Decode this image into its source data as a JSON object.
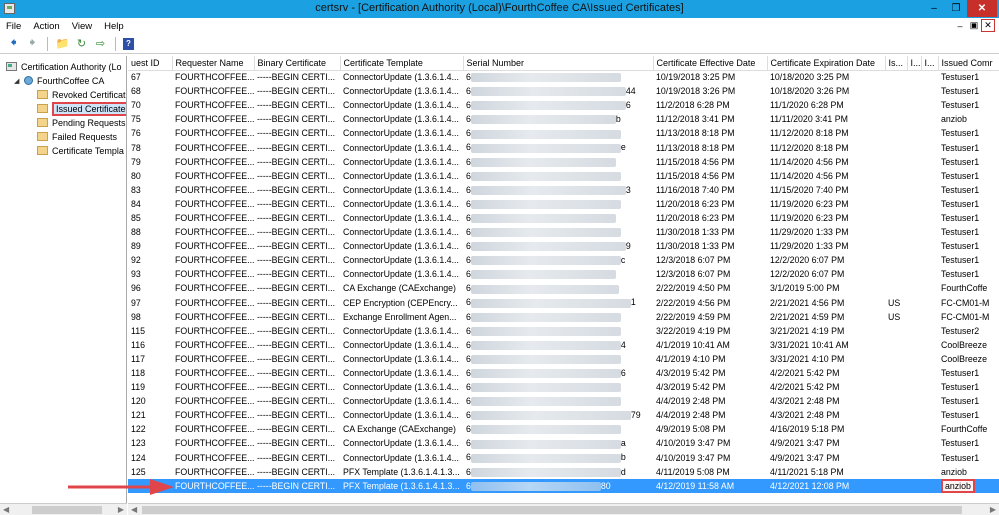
{
  "window": {
    "title": "certsrv - [Certification Authority (Local)\\FourthCoffee CA\\Issued Certificates]",
    "controls": [
      "minimize",
      "restore",
      "close"
    ]
  },
  "menu": {
    "items": [
      "File",
      "Action",
      "View",
      "Help"
    ],
    "mdi_controls": [
      "minimize",
      "restore",
      "close"
    ]
  },
  "toolbar": {
    "buttons": [
      "back-icon",
      "forward-icon",
      "up-folder-icon",
      "refresh-icon",
      "export-icon",
      "help-icon"
    ]
  },
  "tree": {
    "root": "Certification Authority (Local)",
    "ca": "FourthCoffee CA",
    "folders": [
      "Revoked Certificates",
      "Issued Certificates",
      "Pending Requests",
      "Failed Requests",
      "Certificate Templates"
    ],
    "root_shown": "Certification Authority (Lo",
    "folders_shown": [
      "Revoked Certificat",
      "Issued Certificates",
      "Pending Requests",
      "Failed Requests",
      "Certificate Templa"
    ],
    "selected": "Issued Certificates"
  },
  "grid": {
    "columns": [
      "Request ID",
      "Requester Name",
      "Binary Certificate",
      "Certificate Template",
      "Serial Number",
      "Certificate Effective Date",
      "Certificate Expiration Date",
      "Is...",
      "I...",
      "I...",
      "Issued Comm"
    ],
    "columns_shown": [
      "uest ID",
      "Requester Name",
      "Binary Certificate",
      "Certificate Template",
      "Serial Number",
      "Certificate Effective Date",
      "Certificate Expiration Date",
      "Is...",
      "I...",
      "I...",
      "Issued Comr"
    ],
    "rows": [
      {
        "id": "67",
        "requester": "FOURTHCOFFEE...",
        "binary": "-----BEGIN CERTI...",
        "template": "ConnectorUpdate (1.3.6.1.4...",
        "serial_tail": "",
        "effective": "10/19/2018 3:25 PM",
        "expiration": "10/18/2020 3:25 PM",
        "c1": "",
        "c2": "",
        "c3": "",
        "issued_cn": "Testuser1"
      },
      {
        "id": "68",
        "requester": "FOURTHCOFFEE...",
        "binary": "-----BEGIN CERTI...",
        "template": "ConnectorUpdate (1.3.6.1.4...",
        "serial_tail": "44",
        "effective": "10/19/2018 3:26 PM",
        "expiration": "10/18/2020 3:26 PM",
        "c1": "",
        "c2": "",
        "c3": "",
        "issued_cn": "Testuser1"
      },
      {
        "id": "70",
        "requester": "FOURTHCOFFEE...",
        "binary": "-----BEGIN CERTI...",
        "template": "ConnectorUpdate (1.3.6.1.4...",
        "serial_tail": "6",
        "effective": "11/2/2018 6:28 PM",
        "expiration": "11/1/2020 6:28 PM",
        "c1": "",
        "c2": "",
        "c3": "",
        "issued_cn": "Testuser1"
      },
      {
        "id": "75",
        "requester": "FOURTHCOFFEE...",
        "binary": "-----BEGIN CERTI...",
        "template": "ConnectorUpdate (1.3.6.1.4...",
        "serial_tail": "b",
        "effective": "11/12/2018 3:41 PM",
        "expiration": "11/11/2020 3:41 PM",
        "c1": "",
        "c2": "",
        "c3": "",
        "issued_cn": "anziob"
      },
      {
        "id": "76",
        "requester": "FOURTHCOFFEE...",
        "binary": "-----BEGIN CERTI...",
        "template": "ConnectorUpdate (1.3.6.1.4...",
        "serial_tail": "",
        "effective": "11/13/2018 8:18 PM",
        "expiration": "11/12/2020 8:18 PM",
        "c1": "",
        "c2": "",
        "c3": "",
        "issued_cn": "Testuser1"
      },
      {
        "id": "78",
        "requester": "FOURTHCOFFEE...",
        "binary": "-----BEGIN CERTI...",
        "template": "ConnectorUpdate (1.3.6.1.4...",
        "serial_tail": "e",
        "effective": "11/13/2018 8:18 PM",
        "expiration": "11/12/2020 8:18 PM",
        "c1": "",
        "c2": "",
        "c3": "",
        "issued_cn": "Testuser1"
      },
      {
        "id": "79",
        "requester": "FOURTHCOFFEE...",
        "binary": "-----BEGIN CERTI...",
        "template": "ConnectorUpdate (1.3.6.1.4...",
        "serial_tail": "",
        "effective": "11/15/2018 4:56 PM",
        "expiration": "11/14/2020 4:56 PM",
        "c1": "",
        "c2": "",
        "c3": "",
        "issued_cn": "Testuser1"
      },
      {
        "id": "80",
        "requester": "FOURTHCOFFEE...",
        "binary": "-----BEGIN CERTI...",
        "template": "ConnectorUpdate (1.3.6.1.4...",
        "serial_tail": "",
        "effective": "11/15/2018 4:56 PM",
        "expiration": "11/14/2020 4:56 PM",
        "c1": "",
        "c2": "",
        "c3": "",
        "issued_cn": "Testuser1"
      },
      {
        "id": "83",
        "requester": "FOURTHCOFFEE...",
        "binary": "-----BEGIN CERTI...",
        "template": "ConnectorUpdate (1.3.6.1.4...",
        "serial_tail": "3",
        "effective": "11/16/2018 7:40 PM",
        "expiration": "11/15/2020 7:40 PM",
        "c1": "",
        "c2": "",
        "c3": "",
        "issued_cn": "Testuser1"
      },
      {
        "id": "84",
        "requester": "FOURTHCOFFEE...",
        "binary": "-----BEGIN CERTI...",
        "template": "ConnectorUpdate (1.3.6.1.4...",
        "serial_tail": "",
        "effective": "11/20/2018 6:23 PM",
        "expiration": "11/19/2020 6:23 PM",
        "c1": "",
        "c2": "",
        "c3": "",
        "issued_cn": "Testuser1"
      },
      {
        "id": "85",
        "requester": "FOURTHCOFFEE...",
        "binary": "-----BEGIN CERTI...",
        "template": "ConnectorUpdate (1.3.6.1.4...",
        "serial_tail": "",
        "effective": "11/20/2018 6:23 PM",
        "expiration": "11/19/2020 6:23 PM",
        "c1": "",
        "c2": "",
        "c3": "",
        "issued_cn": "Testuser1"
      },
      {
        "id": "88",
        "requester": "FOURTHCOFFEE...",
        "binary": "-----BEGIN CERTI...",
        "template": "ConnectorUpdate (1.3.6.1.4...",
        "serial_tail": "",
        "effective": "11/30/2018 1:33 PM",
        "expiration": "11/29/2020 1:33 PM",
        "c1": "",
        "c2": "",
        "c3": "",
        "issued_cn": "Testuser1"
      },
      {
        "id": "89",
        "requester": "FOURTHCOFFEE...",
        "binary": "-----BEGIN CERTI...",
        "template": "ConnectorUpdate (1.3.6.1.4...",
        "serial_tail": "9",
        "effective": "11/30/2018 1:33 PM",
        "expiration": "11/29/2020 1:33 PM",
        "c1": "",
        "c2": "",
        "c3": "",
        "issued_cn": "Testuser1"
      },
      {
        "id": "92",
        "requester": "FOURTHCOFFEE...",
        "binary": "-----BEGIN CERTI...",
        "template": "ConnectorUpdate (1.3.6.1.4...",
        "serial_tail": "c",
        "effective": "12/3/2018 6:07 PM",
        "expiration": "12/2/2020 6:07 PM",
        "c1": "",
        "c2": "",
        "c3": "",
        "issued_cn": "Testuser1"
      },
      {
        "id": "93",
        "requester": "FOURTHCOFFEE...",
        "binary": "-----BEGIN CERTI...",
        "template": "ConnectorUpdate (1.3.6.1.4...",
        "serial_tail": "",
        "effective": "12/3/2018 6:07 PM",
        "expiration": "12/2/2020 6:07 PM",
        "c1": "",
        "c2": "",
        "c3": "",
        "issued_cn": "Testuser1"
      },
      {
        "id": "96",
        "requester": "FOURTHCOFFEE...",
        "binary": "-----BEGIN CERTI...",
        "template": "CA Exchange (CAExchange)",
        "serial_tail": "",
        "effective": "2/22/2019 4:50 PM",
        "expiration": "3/1/2019 5:00 PM",
        "c1": "",
        "c2": "",
        "c3": "",
        "issued_cn": "FourthCoffe"
      },
      {
        "id": "97",
        "requester": "FOURTHCOFFEE...",
        "binary": "-----BEGIN CERTI...",
        "template": "CEP Encryption (CEPEncry...",
        "serial_tail": "1",
        "effective": "2/22/2019 4:56 PM",
        "expiration": "2/21/2021 4:56 PM",
        "c1": "US",
        "c2": "",
        "c3": "",
        "issued_cn": "FC-CM01-M"
      },
      {
        "id": "98",
        "requester": "FOURTHCOFFEE...",
        "binary": "-----BEGIN CERTI...",
        "template": "Exchange Enrollment Agen...",
        "serial_tail": "",
        "effective": "2/22/2019 4:59 PM",
        "expiration": "2/21/2021 4:59 PM",
        "c1": "US",
        "c2": "",
        "c3": "",
        "issued_cn": "FC-CM01-M"
      },
      {
        "id": "115",
        "requester": "FOURTHCOFFEE...",
        "binary": "-----BEGIN CERTI...",
        "template": "ConnectorUpdate (1.3.6.1.4...",
        "serial_tail": "",
        "effective": "3/22/2019 4:19 PM",
        "expiration": "3/21/2021 4:19 PM",
        "c1": "",
        "c2": "",
        "c3": "",
        "issued_cn": "Testuser2"
      },
      {
        "id": "116",
        "requester": "FOURTHCOFFEE...",
        "binary": "-----BEGIN CERTI...",
        "template": "ConnectorUpdate (1.3.6.1.4...",
        "serial_tail": "4",
        "effective": "4/1/2019 10:41 AM",
        "expiration": "3/31/2021 10:41 AM",
        "c1": "",
        "c2": "",
        "c3": "",
        "issued_cn": "CoolBreeze"
      },
      {
        "id": "117",
        "requester": "FOURTHCOFFEE...",
        "binary": "-----BEGIN CERTI...",
        "template": "ConnectorUpdate (1.3.6.1.4...",
        "serial_tail": "",
        "effective": "4/1/2019 4:10 PM",
        "expiration": "3/31/2021 4:10 PM",
        "c1": "",
        "c2": "",
        "c3": "",
        "issued_cn": "CoolBreeze"
      },
      {
        "id": "118",
        "requester": "FOURTHCOFFEE...",
        "binary": "-----BEGIN CERTI...",
        "template": "ConnectorUpdate (1.3.6.1.4...",
        "serial_tail": "6",
        "effective": "4/3/2019 5:42 PM",
        "expiration": "4/2/2021 5:42 PM",
        "c1": "",
        "c2": "",
        "c3": "",
        "issued_cn": "Testuser1"
      },
      {
        "id": "119",
        "requester": "FOURTHCOFFEE...",
        "binary": "-----BEGIN CERTI...",
        "template": "ConnectorUpdate (1.3.6.1.4...",
        "serial_tail": "",
        "effective": "4/3/2019 5:42 PM",
        "expiration": "4/2/2021 5:42 PM",
        "c1": "",
        "c2": "",
        "c3": "",
        "issued_cn": "Testuser1"
      },
      {
        "id": "120",
        "requester": "FOURTHCOFFEE...",
        "binary": "-----BEGIN CERTI...",
        "template": "ConnectorUpdate (1.3.6.1.4...",
        "serial_tail": "",
        "effective": "4/4/2019 2:48 PM",
        "expiration": "4/3/2021 2:48 PM",
        "c1": "",
        "c2": "",
        "c3": "",
        "issued_cn": "Testuser1"
      },
      {
        "id": "121",
        "requester": "FOURTHCOFFEE...",
        "binary": "-----BEGIN CERTI...",
        "template": "ConnectorUpdate (1.3.6.1.4...",
        "serial_tail": "79",
        "effective": "4/4/2019 2:48 PM",
        "expiration": "4/3/2021 2:48 PM",
        "c1": "",
        "c2": "",
        "c3": "",
        "issued_cn": "Testuser1"
      },
      {
        "id": "122",
        "requester": "FOURTHCOFFEE...",
        "binary": "-----BEGIN CERTI...",
        "template": "CA Exchange (CAExchange)",
        "serial_tail": "",
        "effective": "4/9/2019 5:08 PM",
        "expiration": "4/16/2019 5:18 PM",
        "c1": "",
        "c2": "",
        "c3": "",
        "issued_cn": "FourthCoffe"
      },
      {
        "id": "123",
        "requester": "FOURTHCOFFEE...",
        "binary": "-----BEGIN CERTI...",
        "template": "ConnectorUpdate (1.3.6.1.4...",
        "serial_tail": "a",
        "effective": "4/10/2019 3:47 PM",
        "expiration": "4/9/2021 3:47 PM",
        "c1": "",
        "c2": "",
        "c3": "",
        "issued_cn": "Testuser1"
      },
      {
        "id": "124",
        "requester": "FOURTHCOFFEE...",
        "binary": "-----BEGIN CERTI...",
        "template": "ConnectorUpdate (1.3.6.1.4...",
        "serial_tail": "b",
        "effective": "4/10/2019 3:47 PM",
        "expiration": "4/9/2021 3:47 PM",
        "c1": "",
        "c2": "",
        "c3": "",
        "issued_cn": "Testuser1"
      },
      {
        "id": "125",
        "requester": "FOURTHCOFFEE...",
        "binary": "-----BEGIN CERTI...",
        "template": "PFX Template (1.3.6.1.4.1.3...",
        "serial_tail": "d",
        "effective": "4/11/2019 5:08 PM",
        "expiration": "4/11/2021 5:18 PM",
        "c1": "",
        "c2": "",
        "c3": "",
        "issued_cn": "anziob"
      },
      {
        "id": "",
        "requester": "FOURTHCOFFEE...",
        "binary": "-----BEGIN CERTI...",
        "template": "PFX Template (1.3.6.1.4.1.3...",
        "serial_prefix": "6",
        "serial_tail": "80",
        "effective": "4/12/2019 11:58 AM",
        "expiration": "4/12/2021 12:08 PM",
        "c1": "",
        "c2": "",
        "c3": "",
        "issued_cn": "anziob",
        "selected": true
      }
    ]
  },
  "colors": {
    "titlebar": "#1ba1e2",
    "selection": "#3399ff",
    "highlight_red": "#e0454a"
  }
}
